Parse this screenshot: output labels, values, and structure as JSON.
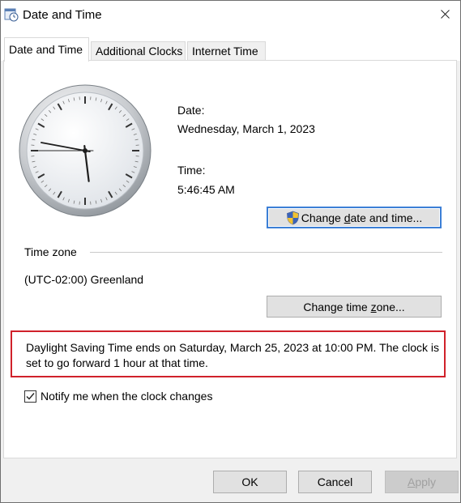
{
  "window": {
    "title": "Date and Time",
    "icon": "calendar-clock-icon",
    "close_icon": "close-icon"
  },
  "tabs": [
    {
      "label": "Date and Time",
      "active": true
    },
    {
      "label": "Additional Clocks",
      "active": false
    },
    {
      "label": "Internet Time",
      "active": false
    }
  ],
  "clock": {
    "hours": 5,
    "minutes": 46,
    "seconds": 45
  },
  "date": {
    "label": "Date:",
    "value": "Wednesday, March 1, 2023"
  },
  "time": {
    "label": "Time:",
    "value": "5:46:45 AM"
  },
  "buttons": {
    "change_date_time": {
      "prefix": "Change ",
      "underlined": "d",
      "suffix": "ate and time...",
      "icon": "uac-shield-icon"
    },
    "change_time_zone": {
      "prefix": "Change time ",
      "underlined": "z",
      "suffix": "one..."
    },
    "ok": "OK",
    "cancel": "Cancel",
    "apply": {
      "prefix": "",
      "underlined": "A",
      "suffix": "pply"
    }
  },
  "timezone": {
    "legend": "Time zone",
    "value": "(UTC-02:00) Greenland"
  },
  "dst_notice": "Daylight Saving Time ends on Saturday, March 25, 2023 at 10:00 PM. The clock is set to go forward 1 hour at that time.",
  "notify": {
    "checked": true,
    "prefix": "",
    "underlined": "N",
    "suffix": "otify me when the clock changes"
  },
  "colors": {
    "highlight_border": "#d0212a",
    "focus_border": "#3c7fd6"
  }
}
